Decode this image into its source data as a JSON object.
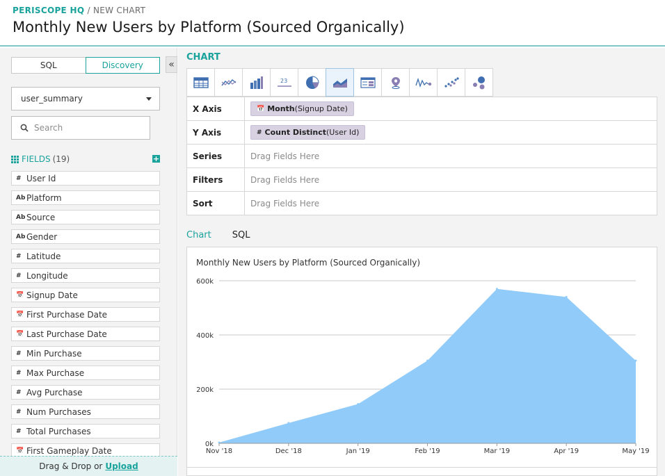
{
  "header": {
    "org": "PERISCOPE HQ",
    "separator": " / ",
    "current": "NEW CHART",
    "title": "Monthly New Users by Platform (Sourced Organically)"
  },
  "sidebar": {
    "mode_tabs": [
      "SQL",
      "Discovery"
    ],
    "active_mode": "Discovery",
    "collapse_glyph": "«",
    "table_select": "user_summary",
    "search_placeholder": "Search",
    "fields_label": "FIELDS",
    "fields_count": "(19)",
    "add_glyph": "+",
    "fields": [
      {
        "type": "#",
        "name": "User Id"
      },
      {
        "type": "Ab",
        "name": "Platform"
      },
      {
        "type": "Ab",
        "name": "Source"
      },
      {
        "type": "Ab",
        "name": "Gender"
      },
      {
        "type": "#",
        "name": "Latitude"
      },
      {
        "type": "#",
        "name": "Longitude"
      },
      {
        "type": "📅",
        "name": "Signup Date"
      },
      {
        "type": "📅",
        "name": "First Purchase Date"
      },
      {
        "type": "📅",
        "name": "Last Purchase Date"
      },
      {
        "type": "#",
        "name": "Min Purchase"
      },
      {
        "type": "#",
        "name": "Max Purchase"
      },
      {
        "type": "#",
        "name": "Avg Purchase"
      },
      {
        "type": "#",
        "name": "Num Purchases"
      },
      {
        "type": "#",
        "name": "Total Purchases"
      },
      {
        "type": "📅",
        "name": "First Gameplay Date"
      }
    ],
    "footer_text": "Drag & Drop or",
    "footer_link": "Upload"
  },
  "main": {
    "section_title": "CHART",
    "chart_types": [
      "table-icon",
      "line-icon",
      "bar-icon",
      "number-icon",
      "pie-icon",
      "area-icon",
      "pivot-icon",
      "map-icon",
      "sparkline-icon",
      "scatter-icon",
      "bubble-icon"
    ],
    "active_chart_type": "area-icon",
    "config": {
      "x_label": "X Axis",
      "x_icon": "📅",
      "x_func": "Month",
      "x_field": "(Signup Date)",
      "y_label": "Y Axis",
      "y_icon": "#",
      "y_func": "Count Distinct",
      "y_field": "(User Id)",
      "series_label": "Series",
      "filters_label": "Filters",
      "sort_label": "Sort",
      "drag_placeholder": "Drag Fields Here"
    },
    "view_tabs": [
      "Chart",
      "SQL"
    ],
    "active_view": "Chart",
    "accent_color": "#1aa39c",
    "area_color": "#90cbf9"
  },
  "chart_data": {
    "type": "area",
    "title": "Monthly New Users by Platform (Sourced Organically)",
    "xlabel": "",
    "ylabel": "",
    "categories": [
      "Nov '18",
      "Dec '18",
      "Jan '19",
      "Feb '19",
      "Mar '19",
      "Apr '19",
      "May '19"
    ],
    "values": [
      3000,
      75000,
      145000,
      305000,
      570000,
      540000,
      305000
    ],
    "ylim": [
      0,
      600000
    ],
    "yticks": [
      0,
      200000,
      400000,
      600000
    ],
    "ytick_labels": [
      "0k",
      "200k",
      "400k",
      "600k"
    ],
    "grid": true
  }
}
